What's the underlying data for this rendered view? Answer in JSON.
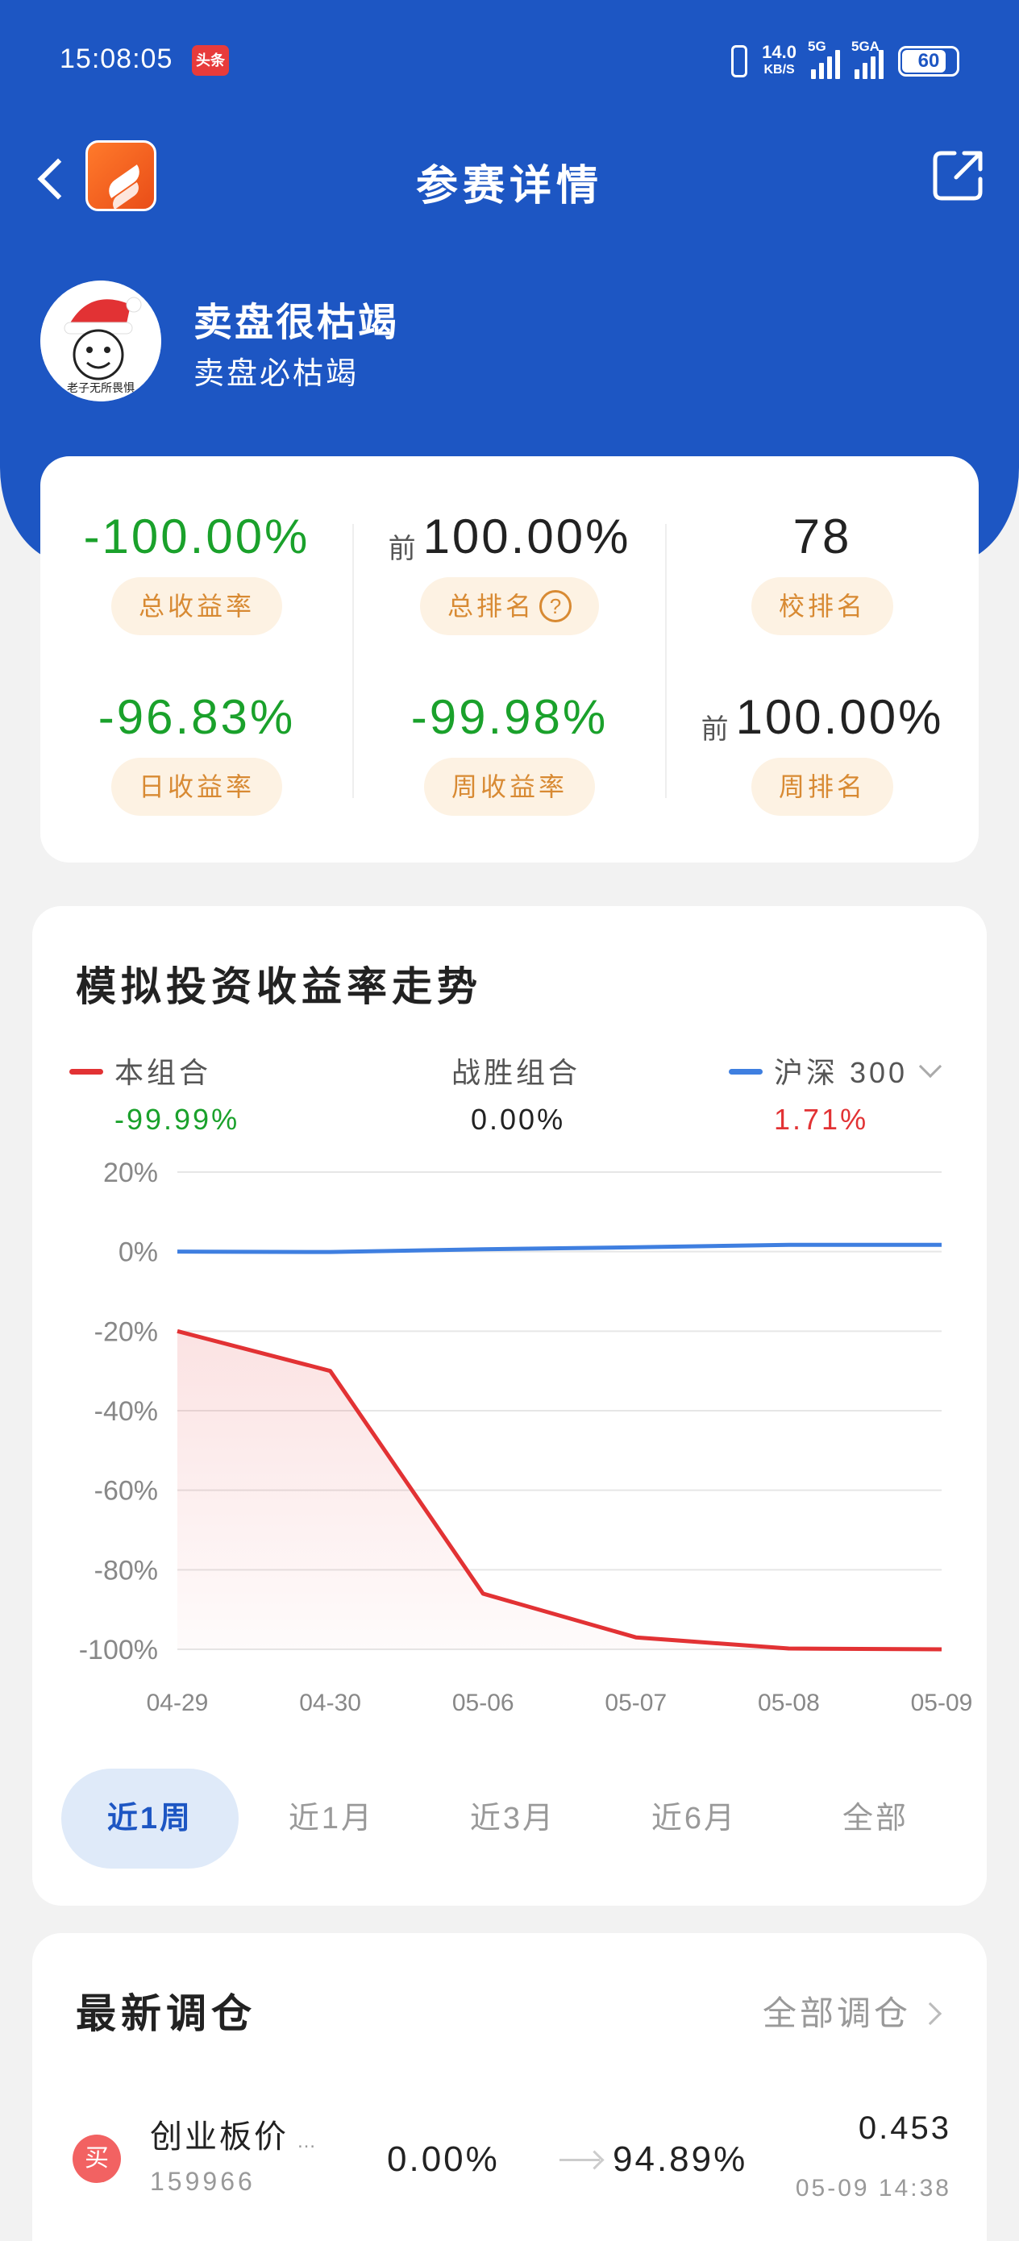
{
  "status_bar": {
    "time": "15:08:05",
    "badge": "头条",
    "speed": "14.0",
    "speed_unit": "KB/S",
    "sig1": "5G",
    "sig2": "5GA",
    "battery": "60"
  },
  "nav": {
    "title": "参赛详情"
  },
  "user": {
    "name": "卖盘很枯竭",
    "subtitle": "卖盘必枯竭",
    "avatar_caption": "老子无所畏惧"
  },
  "stats": [
    {
      "value": "-100.00%",
      "label": "总收益率",
      "color": "#1aa12b"
    },
    {
      "prefix": "前",
      "value": "100.00%",
      "label": "总排名",
      "help": "?",
      "color": "#222222"
    },
    {
      "value": "78",
      "label": "校排名",
      "color": "#222222"
    },
    {
      "value": "-96.83%",
      "label": "日收益率",
      "color": "#1aa12b"
    },
    {
      "value": "-99.98%",
      "label": "周收益率",
      "color": "#1aa12b"
    },
    {
      "prefix": "前",
      "value": "100.00%",
      "label": "周排名",
      "color": "#222222"
    }
  ],
  "chart_title": "模拟投资收益率走势",
  "legend": {
    "mine": {
      "name": "本组合",
      "value": "-99.99%",
      "color": "#e23234",
      "value_color": "#1aa12b"
    },
    "beat": {
      "name": "战胜组合",
      "value": "0.00%"
    },
    "index": {
      "name": "沪深 300",
      "value": "1.71%",
      "color": "#3f7fe0",
      "value_color": "#e23234"
    }
  },
  "chart_data": {
    "type": "line",
    "x": [
      "04-29",
      "04-30",
      "05-06",
      "05-07",
      "05-08",
      "05-09"
    ],
    "y_ticks": [
      "20%",
      "0%",
      "-20%",
      "-40%",
      "-60%",
      "-80%",
      "-100%"
    ],
    "ylim": [
      -100,
      20
    ],
    "grid": true,
    "series": [
      {
        "name": "本组合",
        "values": [
          -20,
          -30,
          -86,
          -97,
          -99.8,
          -99.99
        ],
        "color": "#e23234",
        "area": true
      },
      {
        "name": "沪深 300",
        "values": [
          0,
          -0.1,
          0.6,
          1.1,
          1.7,
          1.71
        ],
        "color": "#3f7fe0"
      }
    ]
  },
  "ranges": [
    "近1周",
    "近1月",
    "近3月",
    "近6月",
    "全部"
  ],
  "active_range": 0,
  "trades": {
    "title": "最新调仓",
    "all_label": "全部调仓",
    "items": [
      {
        "side": "买",
        "name": "创业板价",
        "more": "…",
        "code": "159966",
        "from": "0.00%",
        "to": "94.89%",
        "price": "0.453",
        "time": "05-09 14:38"
      }
    ]
  }
}
